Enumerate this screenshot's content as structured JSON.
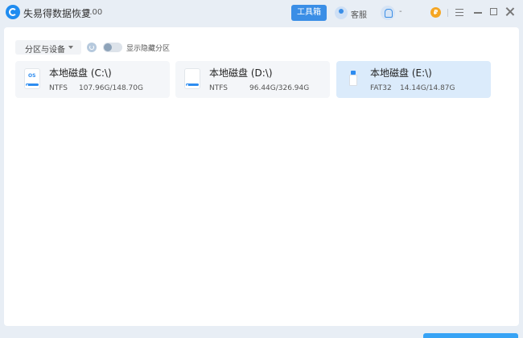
{
  "app": {
    "title": "失易得数据恢复",
    "version": "7.00"
  },
  "header": {
    "tools_label": "工具箱",
    "service_label": "客服",
    "user_suffix": "-"
  },
  "toolbar": {
    "filter_label": "分区与设备",
    "toggle_label": "显示隐藏分区",
    "toggle_on": false
  },
  "drives": [
    {
      "name": "本地磁盘 (C:\\)",
      "fs": "NTFS",
      "usage": "107.96G/148.70G",
      "icon": "os-drive-icon",
      "badge": "OS",
      "selected": false
    },
    {
      "name": "本地磁盘 (D:\\)",
      "fs": "NTFS",
      "usage": "96.44G/326.94G",
      "icon": "hard-drive-icon",
      "selected": false
    },
    {
      "name": "本地磁盘 (E:\\)",
      "fs": "FAT32",
      "usage": "14.14G/14.87G",
      "icon": "usb-drive-icon",
      "selected": true
    }
  ],
  "colors": {
    "accent": "#3a8ee6",
    "selected_bg": "#dbebfb",
    "card_bg": "#f4f6f9"
  }
}
